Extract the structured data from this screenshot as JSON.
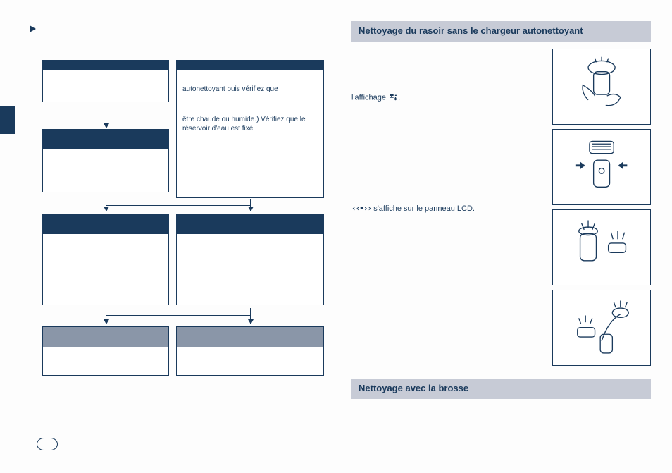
{
  "left": {
    "flow": {
      "box1": {
        "header": "",
        "body": ""
      },
      "box2": {
        "header": "",
        "body_line1": "autonettoyant puis vérifiez que",
        "body_line2": "être chaude ou humide.) Vérifiez que le réservoir d'eau est fixé"
      },
      "box3": {
        "header": "",
        "body": ""
      },
      "box4": {
        "header": "",
        "body": ""
      },
      "box5": {
        "header": "",
        "body": ""
      },
      "box6": {
        "header": "",
        "body": ""
      },
      "box7": {
        "header": "",
        "body": ""
      }
    },
    "page_number": ""
  },
  "right": {
    "heading1": "Nettoyage du rasoir sans le chargeur autonettoyant",
    "para1_prefix": "l'affichage",
    "para1_icon": "tap-icon",
    "para2_icon": "sonic-icon",
    "para2_text": "s'affiche sur le panneau LCD.",
    "heading2": "Nettoyage avec la brosse",
    "illustrations": [
      "shaver-hand-rinse",
      "shaver-head-detach",
      "shaver-parts-rinse",
      "shaver-parts-dry"
    ]
  }
}
